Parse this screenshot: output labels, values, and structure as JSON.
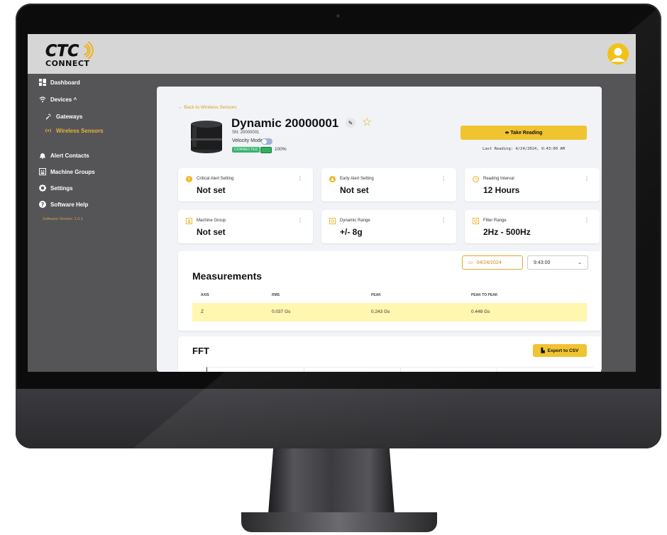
{
  "app": {
    "logo_text": "CTC CONNECT"
  },
  "sidebar": {
    "items": [
      {
        "label": "Dashboard",
        "icon": "dashboard-icon"
      },
      {
        "label": "Devices ^",
        "icon": "wifi-icon"
      },
      {
        "label": "Gateways",
        "icon": "gateway-icon"
      },
      {
        "label": "Wireless Sensors",
        "icon": "signal-icon",
        "active": true
      },
      {
        "label": "Alert Contacts",
        "icon": "bell-icon"
      },
      {
        "label": "Machine Groups",
        "icon": "group-icon"
      },
      {
        "label": "Settings",
        "icon": "gear-icon"
      },
      {
        "label": "Software Help",
        "icon": "help-icon"
      }
    ],
    "version": "Software Version: 1.0.1"
  },
  "device": {
    "back_link": "← Back to Wireless Sensors",
    "title": "Dynamic 20000001",
    "sn": "SN: 20000001",
    "velocity_label": "Velocity Mode:",
    "status": "CONNECTED",
    "battery": "100%",
    "take_reading": "⇹ Take Reading",
    "last_reading": "Last Reading: 4/24/2024, 9:43:00 AM"
  },
  "cards": [
    {
      "label": "Critical Alert Setting",
      "value": "Not set",
      "icon": "alert-icon"
    },
    {
      "label": "Early Alert Setting",
      "value": "Not set",
      "icon": "warning-icon"
    },
    {
      "label": "Reading Interval",
      "value": "12 Hours",
      "icon": "clock-icon"
    },
    {
      "label": "Machine Group",
      "value": "Not set",
      "icon": "group-icon"
    },
    {
      "label": "Dynamic Range",
      "value": "+/- 8g",
      "icon": "range-icon"
    },
    {
      "label": "Filter Range",
      "value": "2Hz - 500Hz",
      "icon": "filter-icon"
    }
  ],
  "measurements": {
    "date": "04/24/2024",
    "time": "9:43:00",
    "title": "Measurements",
    "headers": [
      "AXIS",
      "RMS",
      "PEAK",
      "PEAK TO PEAK"
    ],
    "rows": [
      [
        "Z",
        "0.037 Gs",
        "0.243 Gs",
        "0.448 Gs"
      ]
    ]
  },
  "fft": {
    "title": "FFT",
    "export_label": "Export to CSV"
  },
  "colors": {
    "accent": "#f0c330",
    "sidebar": "#555558",
    "highlight_row": "#fff6b0",
    "connected": "#36b36e"
  }
}
